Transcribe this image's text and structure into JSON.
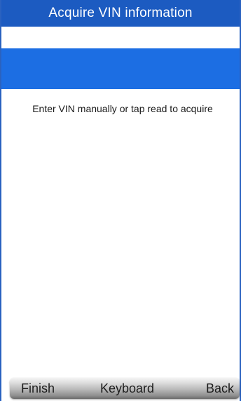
{
  "header": {
    "title": "Acquire VIN information"
  },
  "vin_field": {
    "value": ""
  },
  "main": {
    "message": "Enter VIN manually or tap  read to acquire"
  },
  "toolbar": {
    "finish_label": "Finish",
    "keyboard_label": "Keyboard",
    "back_label": "Back"
  },
  "colors": {
    "title_bar": "#1c5bc1",
    "selected_band": "#1c6ee3",
    "frame_border": "#2a62c0"
  }
}
